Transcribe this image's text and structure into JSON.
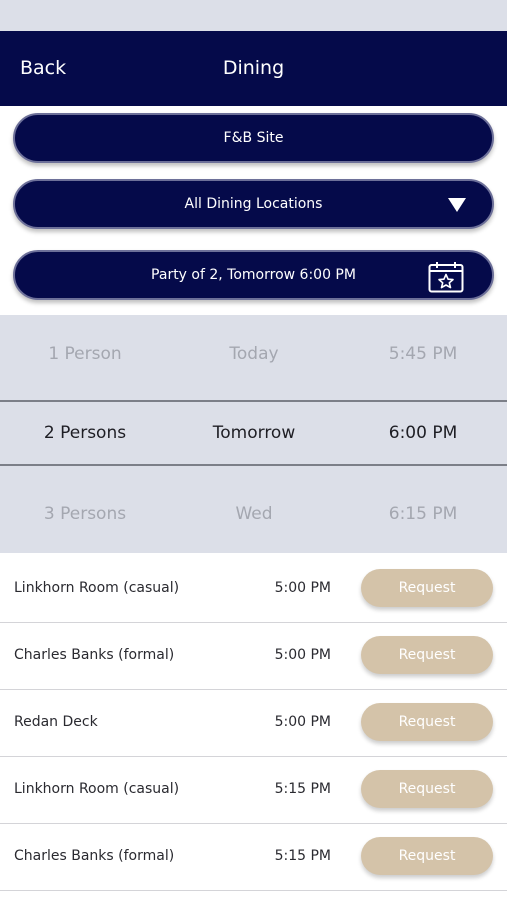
{
  "header": {
    "back_label": "Back",
    "title": "Dining"
  },
  "filters": {
    "site_label": "F&B Site",
    "location_label": "All Dining Locations",
    "party_label": "Party of 2, Tomorrow 6:00 PM"
  },
  "picker": {
    "rows": [
      {
        "persons": "1 Person",
        "day": "Today",
        "time": "5:45 PM"
      },
      {
        "persons": "2 Persons",
        "day": "Tomorrow",
        "time": "6:00 PM"
      },
      {
        "persons": "3 Persons",
        "day": "Wed",
        "time": "6:15 PM"
      }
    ]
  },
  "results": [
    {
      "name": "Linkhorn Room (casual)",
      "time": "5:00 PM",
      "action": "Request"
    },
    {
      "name": "Charles Banks (formal)",
      "time": "5:00 PM",
      "action": "Request"
    },
    {
      "name": "Redan Deck",
      "time": "5:00 PM",
      "action": "Request"
    },
    {
      "name": "Linkhorn Room (casual)",
      "time": "5:15 PM",
      "action": "Request"
    },
    {
      "name": "Charles Banks (formal)",
      "time": "5:15 PM",
      "action": "Request"
    }
  ],
  "colors": {
    "navy": "#050a4a",
    "picker_bg": "#dcdfe8",
    "request_tan": "#d4c3a9"
  },
  "icons": {
    "location_dropdown": "chevron-down-icon",
    "party_picker": "calendar-star-icon"
  }
}
